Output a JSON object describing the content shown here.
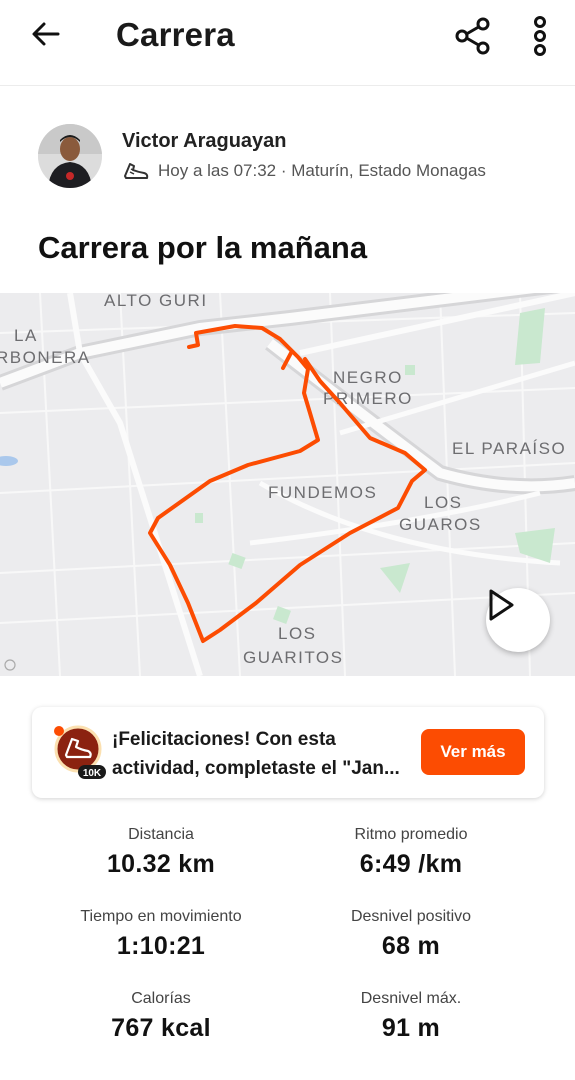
{
  "header": {
    "title": "Carrera",
    "back_icon": "arrow-left-icon",
    "share_icon": "share-icon",
    "more_icon": "more-vertical-icon"
  },
  "athlete": {
    "name": "Victor Araguayan",
    "meta": "Hoy a las 07:32 · Maturín, Estado Monagas",
    "sport_icon": "running-shoe-icon"
  },
  "activity": {
    "title": "Carrera por la mañana"
  },
  "map": {
    "labels": {
      "alto_guri": "ALTO GURI",
      "la": "LA",
      "carbonera": "RBONERA",
      "negro": "NEGRO",
      "primero": "PRIMERO",
      "el_paraiso": "EL PARAÍSO",
      "fundemos": "FUNDEMOS",
      "los": "LOS",
      "guaros": "GUAROS",
      "los2": "LOS",
      "guaritos": "GUARITOS"
    },
    "route_color": "#fc4c02",
    "play_icon": "play-icon"
  },
  "banner": {
    "line1": "¡Felicitaciones! Con esta",
    "line2": "actividad, completaste el \"Jan...",
    "badge_label": "10K",
    "button": "Ver más",
    "accent": "#fc4c02"
  },
  "stats": [
    {
      "label": "Distancia",
      "value": "10.32 km"
    },
    {
      "label": "Ritmo promedio",
      "value": "6:49 /km"
    },
    {
      "label": "Tiempo en movimiento",
      "value": "1:10:21"
    },
    {
      "label": "Desnivel positivo",
      "value": "68 m"
    },
    {
      "label": "Calorías",
      "value": "767 kcal"
    },
    {
      "label": "Desnivel máx.",
      "value": "91 m"
    }
  ]
}
